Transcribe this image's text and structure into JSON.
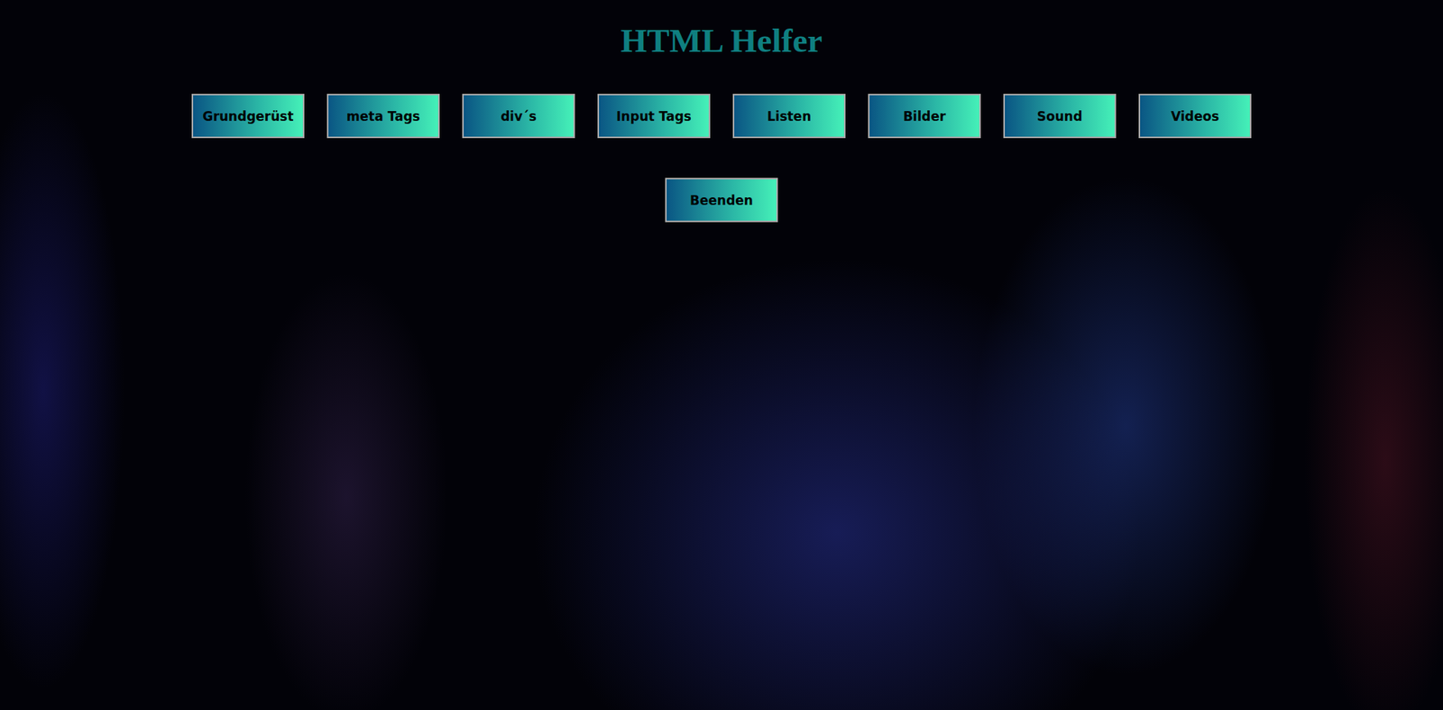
{
  "title": "HTML Helfer",
  "buttons": [
    {
      "label": "Grundgerüst"
    },
    {
      "label": "meta Tags"
    },
    {
      "label": "div´s"
    },
    {
      "label": "Input Tags"
    },
    {
      "label": "Listen"
    },
    {
      "label": "Bilder"
    },
    {
      "label": "Sound"
    },
    {
      "label": "Videos"
    },
    {
      "label": "Beenden"
    }
  ]
}
